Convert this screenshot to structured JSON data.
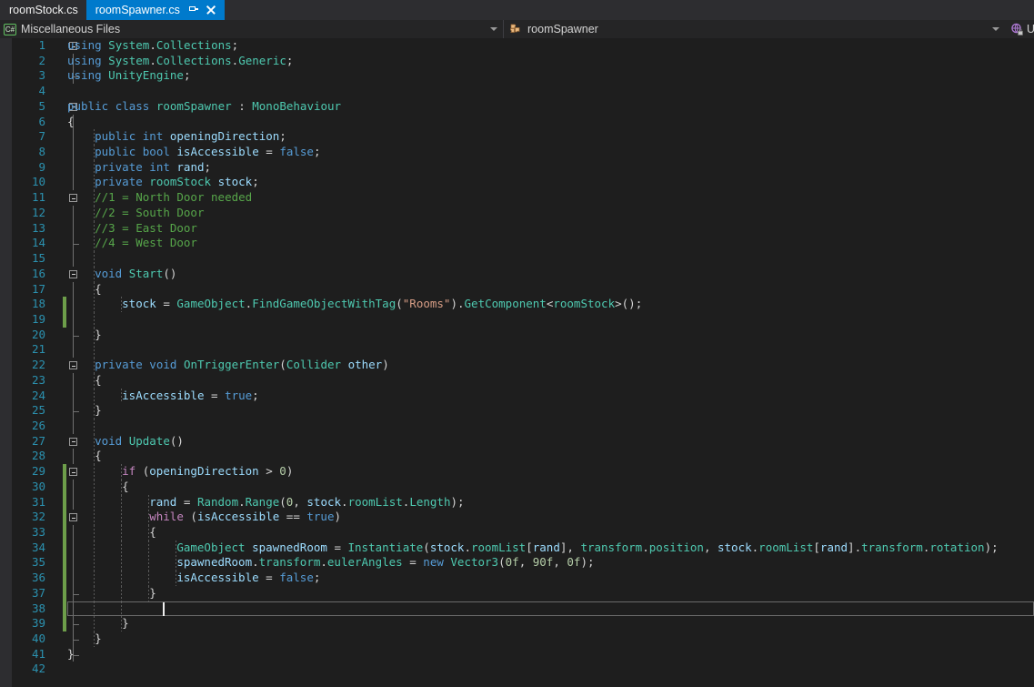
{
  "window": {
    "background_color": "#1E1E1E",
    "accent_color": "#007ACC"
  },
  "tabs": [
    {
      "label": "roomStock.cs",
      "active": false
    },
    {
      "label": "roomSpawner.cs",
      "active": true,
      "pin_icon": "pin-icon",
      "close_icon": "close-icon"
    }
  ],
  "navbar": {
    "left": {
      "icon": "csharp-file-icon",
      "icon_label": "C#",
      "value": "Miscellaneous Files",
      "dropdown_icon": "chevron-down-icon"
    },
    "right": {
      "icon": "class-puzzle-icon",
      "value": "roomSpawner",
      "dropdown_icon": "chevron-down-icon"
    },
    "right_edge": {
      "lock_icon": "lock-object-icon",
      "clipped_text": "U"
    }
  },
  "editor": {
    "language": "csharp",
    "current_line": 38,
    "caret_column": 14,
    "total_visible_lines": 42,
    "lines": [
      {
        "n": 1,
        "text": "using System.Collections;"
      },
      {
        "n": 2,
        "text": "using System.Collections.Generic;"
      },
      {
        "n": 3,
        "text": "using UnityEngine;"
      },
      {
        "n": 4,
        "text": ""
      },
      {
        "n": 5,
        "text": "public class roomSpawner : MonoBehaviour"
      },
      {
        "n": 6,
        "text": "{"
      },
      {
        "n": 7,
        "text": "    public int openingDirection;"
      },
      {
        "n": 8,
        "text": "    public bool isAccessible = false;"
      },
      {
        "n": 9,
        "text": "    private int rand;"
      },
      {
        "n": 10,
        "text": "    private roomStock stock;"
      },
      {
        "n": 11,
        "text": "    //1 = North Door needed"
      },
      {
        "n": 12,
        "text": "    //2 = South Door"
      },
      {
        "n": 13,
        "text": "    //3 = East Door"
      },
      {
        "n": 14,
        "text": "    //4 = West Door"
      },
      {
        "n": 15,
        "text": ""
      },
      {
        "n": 16,
        "text": "    void Start()"
      },
      {
        "n": 17,
        "text": "    {"
      },
      {
        "n": 18,
        "text": "        stock = GameObject.FindGameObjectWithTag(\"Rooms\").GetComponent<roomStock>();"
      },
      {
        "n": 19,
        "text": ""
      },
      {
        "n": 20,
        "text": "    }"
      },
      {
        "n": 21,
        "text": ""
      },
      {
        "n": 22,
        "text": "    private void OnTriggerEnter(Collider other)"
      },
      {
        "n": 23,
        "text": "    {"
      },
      {
        "n": 24,
        "text": "        isAccessible = true;"
      },
      {
        "n": 25,
        "text": "    }"
      },
      {
        "n": 26,
        "text": ""
      },
      {
        "n": 27,
        "text": "    void Update()"
      },
      {
        "n": 28,
        "text": "    {"
      },
      {
        "n": 29,
        "text": "        if (openingDirection > 0)"
      },
      {
        "n": 30,
        "text": "        {"
      },
      {
        "n": 31,
        "text": "            rand = Random.Range(0, stock.roomList.Length);"
      },
      {
        "n": 32,
        "text": "            while (isAccessible == true)"
      },
      {
        "n": 33,
        "text": "            {"
      },
      {
        "n": 34,
        "text": "                GameObject spawnedRoom = Instantiate(stock.roomList[rand], transform.position, stock.roomList[rand].transform.rotation);"
      },
      {
        "n": 35,
        "text": "                spawnedRoom.transform.eulerAngles = new Vector3(0f, 90f, 0f);"
      },
      {
        "n": 36,
        "text": "                isAccessible = false;"
      },
      {
        "n": 37,
        "text": "            }"
      },
      {
        "n": 38,
        "text": ""
      },
      {
        "n": 39,
        "text": "        }"
      },
      {
        "n": 40,
        "text": "    }"
      },
      {
        "n": 41,
        "text": "}"
      },
      {
        "n": 42,
        "text": ""
      }
    ],
    "changed_lines_saved": [
      18,
      19,
      29,
      30,
      31,
      32,
      33,
      34,
      35,
      36,
      37,
      38,
      39
    ],
    "collapse_markers": [
      1,
      5,
      11,
      16,
      22,
      27,
      29,
      32
    ],
    "syntax_colors": {
      "keyword": "#569CD6",
      "control_keyword": "#C586C0",
      "type": "#4EC9B0",
      "string": "#D69D85",
      "comment": "#57A64A",
      "number": "#B5CEA8",
      "identifier": "#9CDCFE",
      "plain": "#D4D4D4",
      "line_number": "#2B91AF",
      "change_bar_saved": "#6D9E4A"
    }
  }
}
